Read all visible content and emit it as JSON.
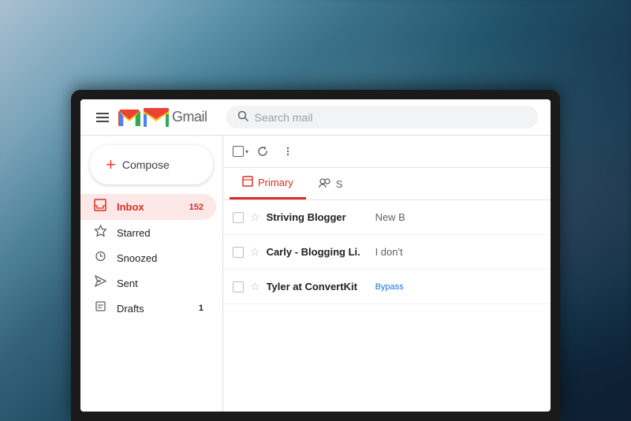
{
  "background": {
    "colors": [
      "#c5d8e8",
      "#4a7a8a",
      "#1e4a60",
      "#0e1e30"
    ]
  },
  "gmail": {
    "title": "Gmail",
    "search_placeholder": "Search mail",
    "compose_label": "Compose",
    "nav_items": [
      {
        "id": "inbox",
        "label": "Inbox",
        "icon": "inbox",
        "badge": "152",
        "active": true
      },
      {
        "id": "starred",
        "label": "Starred",
        "icon": "star",
        "badge": "",
        "active": false
      },
      {
        "id": "snoozed",
        "label": "Snoozed",
        "icon": "clock",
        "badge": "",
        "active": false
      },
      {
        "id": "sent",
        "label": "Sent",
        "icon": "send",
        "badge": "",
        "active": false
      },
      {
        "id": "drafts",
        "label": "Drafts",
        "icon": "drafts",
        "badge": "1",
        "active": false
      }
    ],
    "tabs": [
      {
        "id": "primary",
        "label": "Primary",
        "active": true
      },
      {
        "id": "social",
        "label": "S",
        "active": false
      }
    ],
    "emails": [
      {
        "sender": "Striving Blogger",
        "preview": "New B",
        "badge": "New B"
      },
      {
        "sender": "Carly - Blogging Li.",
        "preview": "I don't",
        "badge": ""
      },
      {
        "sender": "Tyler at ConvertKit",
        "preview": "Bypass",
        "badge": "Bypass"
      }
    ]
  }
}
